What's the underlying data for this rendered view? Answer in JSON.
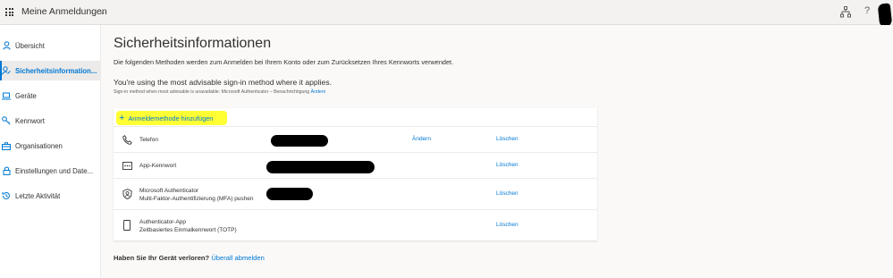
{
  "header": {
    "app_title": "Meine Anmeldungen",
    "icons": [
      "waffle-icon",
      "chevron-down-icon",
      "org-chart-icon",
      "help-icon",
      "avatar"
    ],
    "help_glyph": "?"
  },
  "sidebar": {
    "items": [
      {
        "label": "Übersicht",
        "icon": "person-icon"
      },
      {
        "label": "Sicherheitsinformation...",
        "icon": "security-info-icon",
        "active": true
      },
      {
        "label": "Geräte",
        "icon": "laptop-icon"
      },
      {
        "label": "Kennwort",
        "icon": "key-icon"
      },
      {
        "label": "Organisationen",
        "icon": "briefcase-icon"
      },
      {
        "label": "Einstellungen und Date...",
        "icon": "lock-icon"
      },
      {
        "label": "Letzte Aktivität",
        "icon": "history-icon"
      }
    ]
  },
  "main": {
    "title": "Sicherheitsinformationen",
    "description": "Die folgenden Methoden werden zum Anmelden bei Ihrem Konto oder zum Zurücksetzen Ihres Kennworts verwendet.",
    "advisable": "You're using the most advisable sign-in method where it applies.",
    "advisable_sub": "Sign-in method when most advisable is unavailable: Microsoft Authenticator – Benachrichtigung",
    "advisable_sub_link": "Ändern",
    "add_method_label": "Anmeldemethode hinzufügen",
    "methods": [
      {
        "name": "Telefon",
        "name2": "",
        "icon": "phone-icon",
        "change": "Ändern",
        "delete": "Löschen"
      },
      {
        "name": "App-Kennwort",
        "name2": "",
        "icon": "app-password-icon",
        "change": "",
        "delete": "Löschen"
      },
      {
        "name": "Microsoft Authenticator",
        "name2": "Multi-Faktor-Authentifizierung (MFA) pushen",
        "icon": "authenticator-icon",
        "change": "",
        "delete": "Löschen"
      },
      {
        "name": "Authenticator-App",
        "name2": "Zeitbasiertes Einmalkennwort (TOTP)",
        "icon": "mobile-icon",
        "change": "",
        "delete": "Löschen"
      }
    ],
    "lost_device": "Haben Sie Ihr Gerät verloren?",
    "lost_device_link": "Überall abmelden"
  },
  "colors": {
    "accent": "#0078d4",
    "highlight": "#ffff34",
    "redaction": "#000000"
  }
}
